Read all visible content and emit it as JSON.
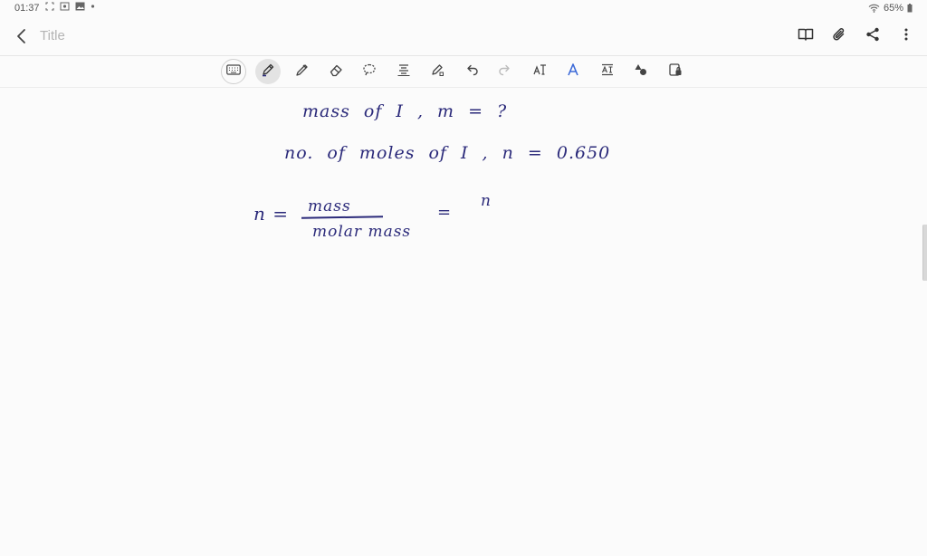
{
  "status": {
    "time": "01:37",
    "battery": "65%"
  },
  "appbar": {
    "title_placeholder": "Title"
  },
  "toolbar": {
    "tools": [
      "keyboard",
      "pen",
      "highlighter",
      "eraser",
      "lasso",
      "text-align",
      "shape-pen",
      "undo",
      "redo",
      "text-box",
      "ai-assist",
      "text-format",
      "shapes",
      "insert-image"
    ],
    "selected": "pen"
  },
  "note": {
    "line1": "mass of I , m = ?",
    "line2": "no. of moles of I , n = 0.650",
    "eq_lhs": "n =",
    "eq_num": "mass",
    "eq_den": "molar mass",
    "eq_eq": "=",
    "eq_rhs": "n"
  },
  "colors": {
    "ink": "#2b2a7a",
    "accent": "#3c6ad8"
  }
}
